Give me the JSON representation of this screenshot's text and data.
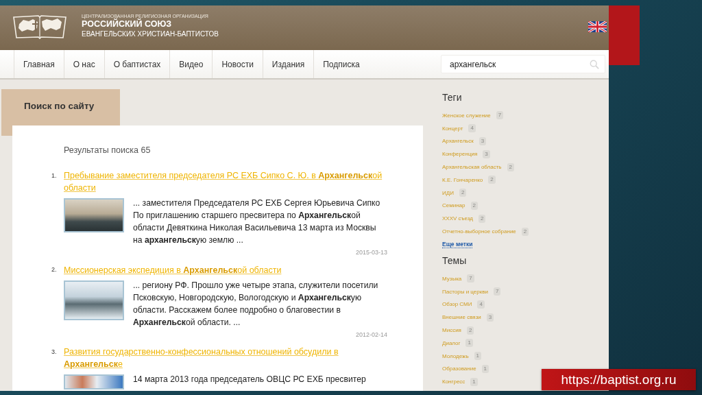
{
  "header": {
    "org_type": "ЦЕНТРАЛИЗОВАННАЯ РЕЛИГИОЗНАЯ ОРГАНИЗАЦИЯ",
    "org_name": "РОССИЙСКИЙ СОЮЗ",
    "org_subtitle": "ЕВАНГЕЛЬСКИХ ХРИСТИАН-БАПТИСТОВ"
  },
  "nav": {
    "items": [
      {
        "label": "Главная"
      },
      {
        "label": "О нас"
      },
      {
        "label": "О баптистах"
      },
      {
        "label": "Видео"
      },
      {
        "label": "Новости"
      },
      {
        "label": "Издания"
      },
      {
        "label": "Подписка"
      }
    ],
    "search": {
      "value": "архангельск"
    }
  },
  "page_tab": "Поиск по сайту",
  "results": {
    "heading": "Результаты поиска 65",
    "items": [
      {
        "number": "1.",
        "title": "Пребывание заместителя председателя РС ЕХБ Сипко С. Ю. в **Архангельск**ой области",
        "snippet": "... заместителя Председателя РС ЕХБ Сергея Юрьевича Сипко По приглашению старшего пресвитера по **Архангельск**ой области Девяткина Николая Васильевича 13 марта из Москвы на **архангельск**ую землю ...",
        "date": "2015-03-13"
      },
      {
        "number": "2.",
        "title": "Миссионерская экспедиция в **Архангельск**ой области",
        "snippet": "... региону РФ. Прошло уже четыре этапа, служители посетили Псковскую, Новгородскую, Вологодскую и **Архангельск**ую области. Расскажем более подробно о благовестии в **Архангельск**ой области. ...",
        "date": "2012-02-14"
      },
      {
        "number": "3.",
        "title": "Развития государственно-конфессиональных отношений обсудили в **Архангельск**е",
        "snippet": "14 марта 2013 года председатель ОВЦС РС ЕХБ пресвитер"
      }
    ]
  },
  "sidebar": {
    "tags": {
      "heading": "Теги",
      "items": [
        {
          "label": "Женское служение",
          "count": "7"
        },
        {
          "label": "Концерт",
          "count": "4"
        },
        {
          "label": "Архангельск",
          "count": "3"
        },
        {
          "label": "Конференция",
          "count": "3"
        },
        {
          "label": "Архангельская область",
          "count": "2"
        },
        {
          "label": "К.Е. Гончаренко",
          "count": "2"
        },
        {
          "label": "ИДИ",
          "count": "2"
        },
        {
          "label": "Семинар",
          "count": "2"
        },
        {
          "label": "XXXV съезд",
          "count": "2"
        },
        {
          "label": "Отчетно-выборное собрание",
          "count": "2"
        }
      ],
      "more_link": "Еще метки"
    },
    "topics": {
      "heading": "Темы",
      "items": [
        {
          "label": "Музыка",
          "count": "7"
        },
        {
          "label": "Пасторы и церкви",
          "count": "7"
        },
        {
          "label": "Обзор СМИ",
          "count": "4"
        },
        {
          "label": "Внешние связи",
          "count": "3"
        },
        {
          "label": "Миссия",
          "count": "2"
        },
        {
          "label": "Диалог",
          "count": "1"
        },
        {
          "label": "Молодежь",
          "count": "1"
        },
        {
          "label": "Образование",
          "count": "1"
        },
        {
          "label": "Конгресс",
          "count": "1"
        }
      ]
    }
  },
  "caption": "https://baptist.org.ru"
}
